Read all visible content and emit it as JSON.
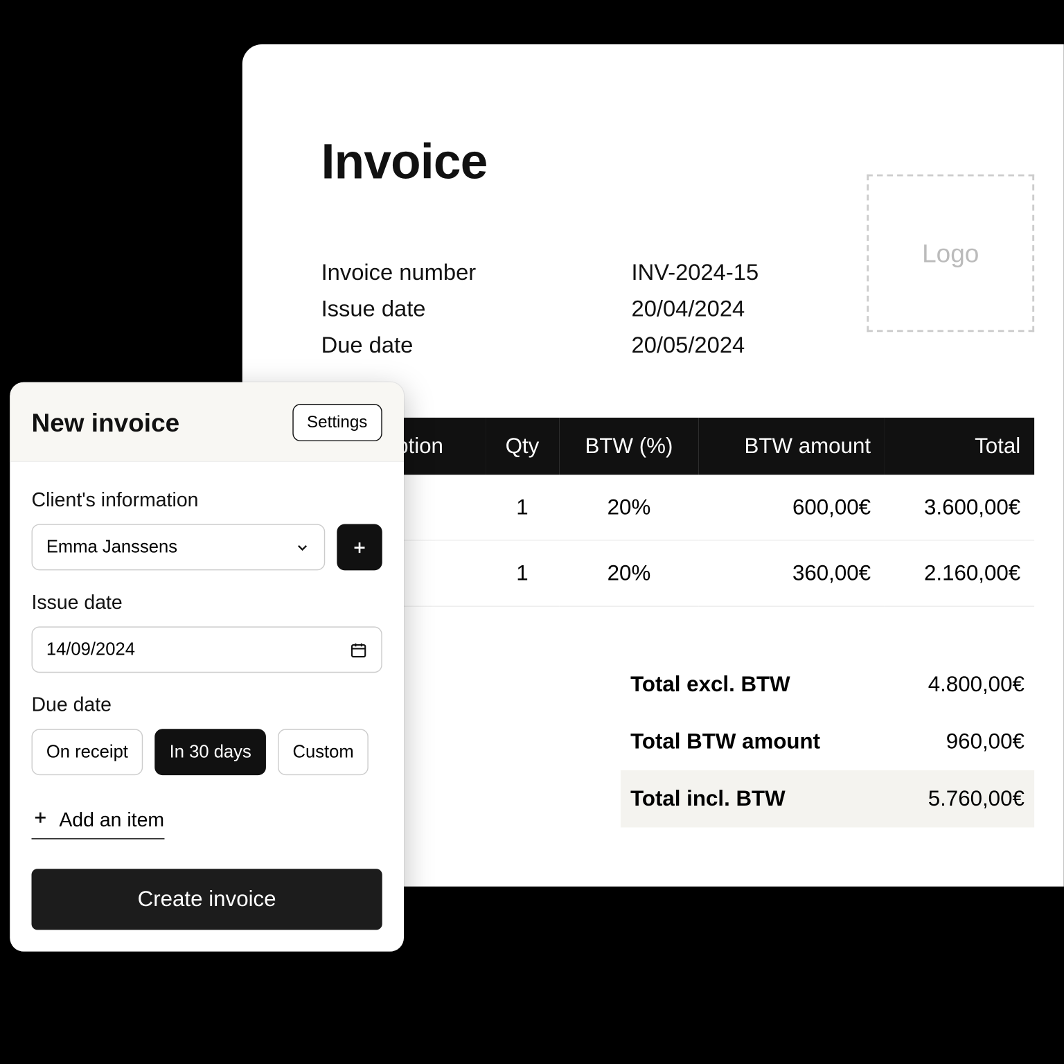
{
  "invoice": {
    "title": "Invoice",
    "logo_placeholder": "Logo",
    "meta": {
      "number_label": "Invoice number",
      "number_value": "INV-2024-15",
      "issue_label": "Issue date",
      "issue_value": "20/04/2024",
      "due_label": "Due date",
      "due_value": "20/05/2024"
    },
    "columns": {
      "description": "Description",
      "qty": "Qty",
      "btw_pct": "BTW (%)",
      "btw_amount": "BTW amount",
      "total": "Total"
    },
    "rows": [
      {
        "qty": "1",
        "btw_pct": "20%",
        "btw_amount": "600,00€",
        "total": "3.600,00€"
      },
      {
        "qty": "1",
        "btw_pct": "20%",
        "btw_amount": "360,00€",
        "total": "2.160,00€"
      }
    ],
    "totals": {
      "excl_label": "Total excl. BTW",
      "excl_value": "4.800,00€",
      "btw_label": "Total BTW amount",
      "btw_value": "960,00€",
      "incl_label": "Total incl. BTW",
      "incl_value": "5.760,00€"
    }
  },
  "panel": {
    "title": "New invoice",
    "settings": "Settings",
    "client_label": "Client's information",
    "client_value": "Emma Janssens",
    "issue_label": "Issue date",
    "issue_value": "14/09/2024",
    "due_label": "Due date",
    "due_options": {
      "on_receipt": "On receipt",
      "in_30": "In 30 days",
      "custom": "Custom"
    },
    "add_item": "Add an item",
    "create": "Create invoice"
  }
}
